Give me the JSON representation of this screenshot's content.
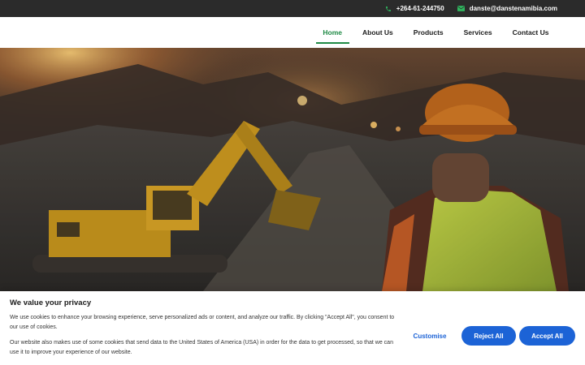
{
  "topbar": {
    "phone": "+264-61-244750",
    "email": "danste@danstenamibia.com",
    "icon_color": "#2fb55e"
  },
  "nav": {
    "items": [
      {
        "label": "Home",
        "active": true
      },
      {
        "label": "About Us",
        "active": false
      },
      {
        "label": "Products",
        "active": false
      },
      {
        "label": "Services",
        "active": false
      },
      {
        "label": "Contact Us",
        "active": false
      }
    ],
    "active_color": "#1f8a45"
  },
  "hero": {
    "image_subject": "excavator at mining site at sunset, worker in hard hat and high-visibility vest"
  },
  "cookie": {
    "title": "We value your privacy",
    "text1": "We use cookies to enhance your browsing experience, serve personalized ads or content, and analyze our traffic. By clicking \"Accept All\", you consent to our use of cookies.",
    "text2": "Our website also makes use of some cookies that send data to the United States of America (USA) in order for the data to get processed, so that we can use it to improve your experience of our website.",
    "customise_label": "Customise",
    "reject_label": "Reject All",
    "accept_label": "Accept All",
    "button_color": "#1c63d6"
  }
}
